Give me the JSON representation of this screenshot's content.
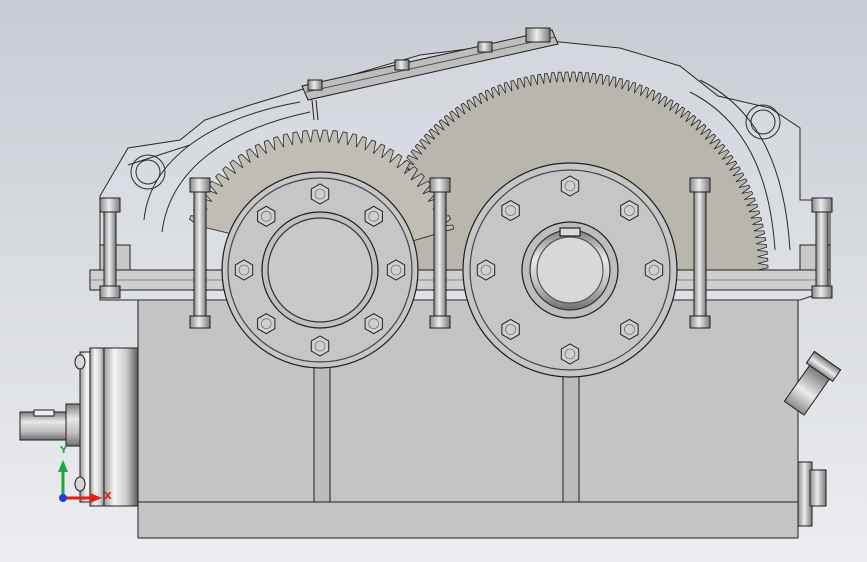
{
  "viewport": {
    "background_top": "#c9ccd3",
    "background_bottom": "#ebedf1"
  },
  "model": {
    "housing_color": "#c4c4c4",
    "housing_shade": "#a9a9a9",
    "line_color": "#1e1e1e",
    "gear_color": "#b9b6ae",
    "transparent_cover": "rgba(225,228,235,0.35)",
    "input_shaft_color": "#c9c9c9"
  },
  "triad": {
    "x_label": "X",
    "y_label": "Y",
    "x_color": "#e0201c",
    "y_color": "#1fa83a",
    "z_color": "#1e3fd6"
  }
}
